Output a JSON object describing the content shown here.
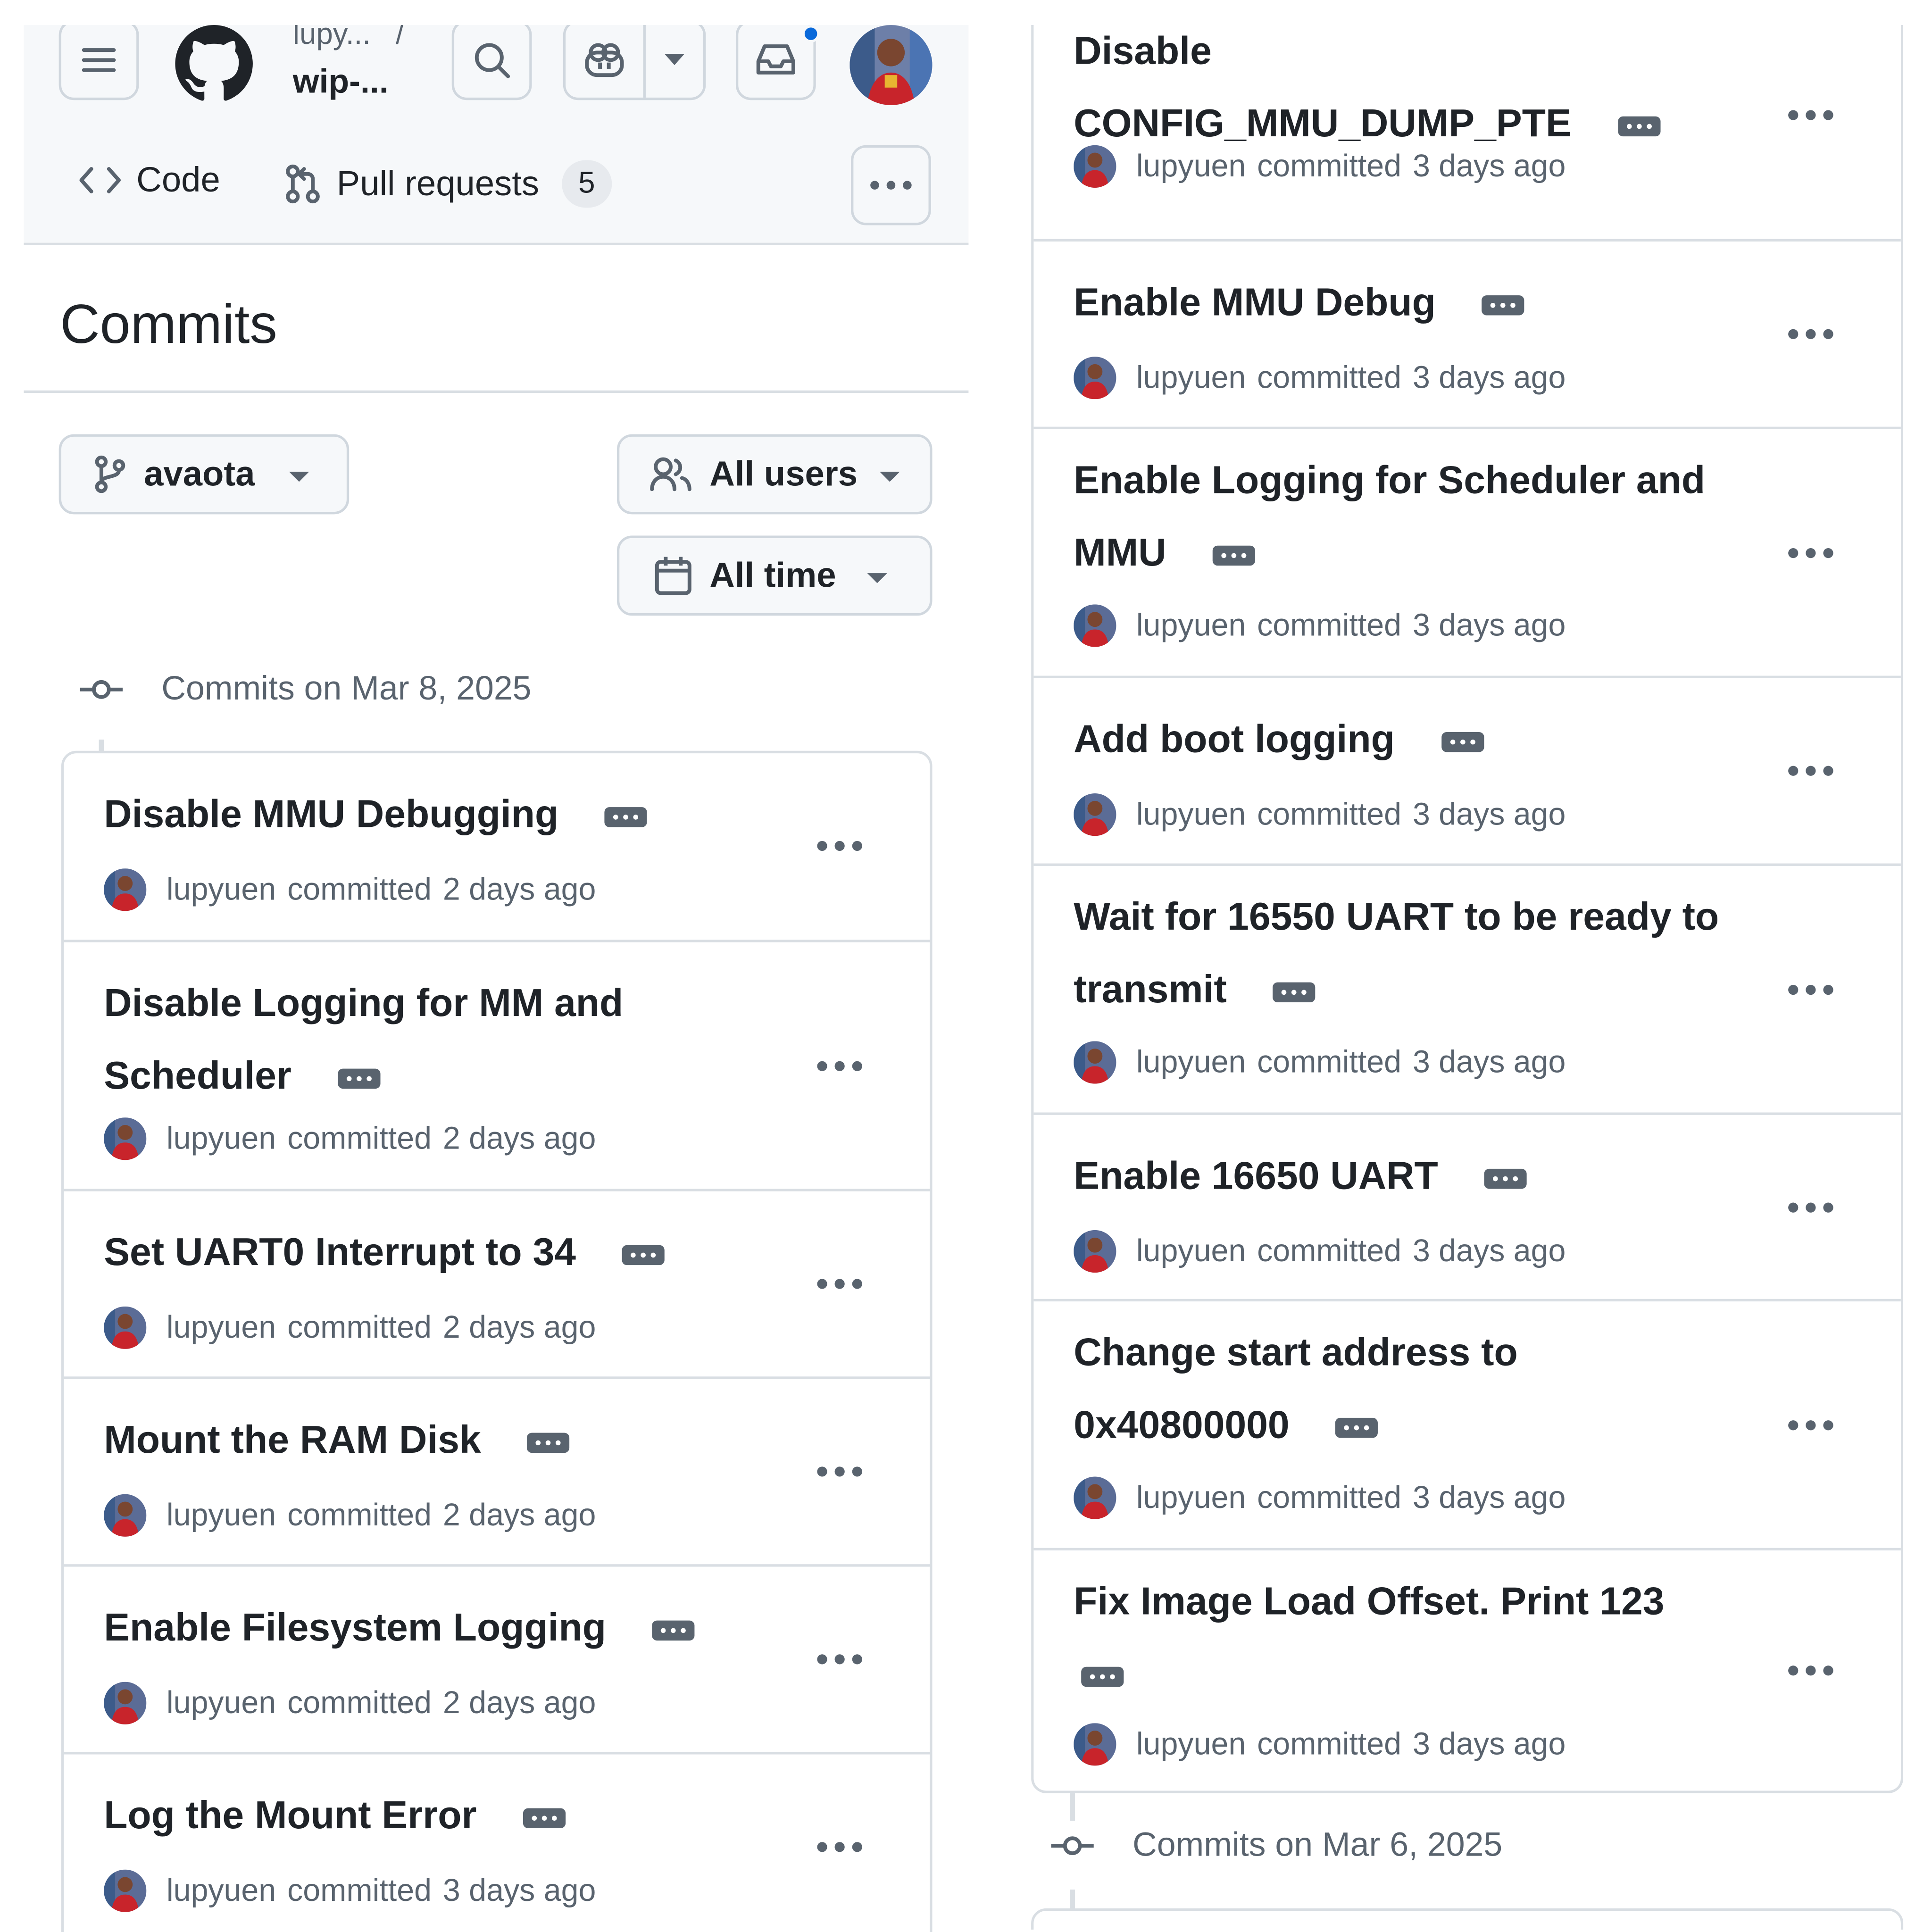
{
  "header": {
    "owner": "lupy...",
    "separator": "/",
    "repo": "wip-...",
    "tabs": {
      "code": "Code",
      "pulls": "Pull requests",
      "pulls_count": "5"
    }
  },
  "page_title": "Commits",
  "filters": {
    "branch": "avaota",
    "users": "All users",
    "time": "All time"
  },
  "icons": [
    "menu-icon",
    "github-logo-icon",
    "search-icon",
    "copilot-icon",
    "chevron-down-icon",
    "inbox-icon",
    "code-icon",
    "pull-request-icon",
    "kebab-horizontal-icon",
    "git-branch-icon",
    "people-icon",
    "calendar-icon",
    "git-commit-icon",
    "ellipsis-expander-icon"
  ],
  "left_group": {
    "heading": "Commits on Mar 8, 2025",
    "commits": [
      {
        "title": "Disable MMU Debugging",
        "author": "lupyuen",
        "action": "committed",
        "when": "2 days ago"
      },
      {
        "title": "Disable Logging for MM and Scheduler",
        "author": "lupyuen",
        "action": "committed",
        "when": "2 days ago"
      },
      {
        "title": "Set UART0 Interrupt to 34",
        "author": "lupyuen",
        "action": "committed",
        "when": "2 days ago"
      },
      {
        "title": "Mount the RAM Disk",
        "author": "lupyuen",
        "action": "committed",
        "when": "2 days ago"
      },
      {
        "title": "Enable Filesystem Logging",
        "author": "lupyuen",
        "action": "committed",
        "when": "2 days ago"
      },
      {
        "title": "Log the Mount Error",
        "author": "lupyuen",
        "action": "committed",
        "when": "3 days ago"
      }
    ]
  },
  "right_group": {
    "commits": [
      {
        "title": "Disable CONFIG_MMU_DUMP_PTE",
        "author": "lupyuen",
        "action": "committed",
        "when": "3 days ago"
      },
      {
        "title": "Enable MMU Debug",
        "author": "lupyuen",
        "action": "committed",
        "when": "3 days ago"
      },
      {
        "title": "Enable Logging for Scheduler and MMU",
        "author": "lupyuen",
        "action": "committed",
        "when": "3 days ago"
      },
      {
        "title": "Add boot logging",
        "author": "lupyuen",
        "action": "committed",
        "when": "3 days ago"
      },
      {
        "title": "Wait for 16550 UART to be ready to transmit",
        "author": "lupyuen",
        "action": "committed",
        "when": "3 days ago"
      },
      {
        "title": "Enable 16650 UART",
        "author": "lupyuen",
        "action": "committed",
        "when": "3 days ago"
      },
      {
        "title": "Change start address to 0x40800000",
        "author": "lupyuen",
        "action": "committed",
        "when": "3 days ago"
      },
      {
        "title": "Fix Image Load Offset. Print 123",
        "author": "lupyuen",
        "action": "committed",
        "when": "3 days ago"
      }
    ]
  },
  "next_group": {
    "heading": "Commits on Mar 6, 2025"
  },
  "colors": {
    "accent": "#0969da",
    "border": "#d0d7de",
    "muted": "#59636e",
    "header_bg": "#f6f8fa"
  }
}
